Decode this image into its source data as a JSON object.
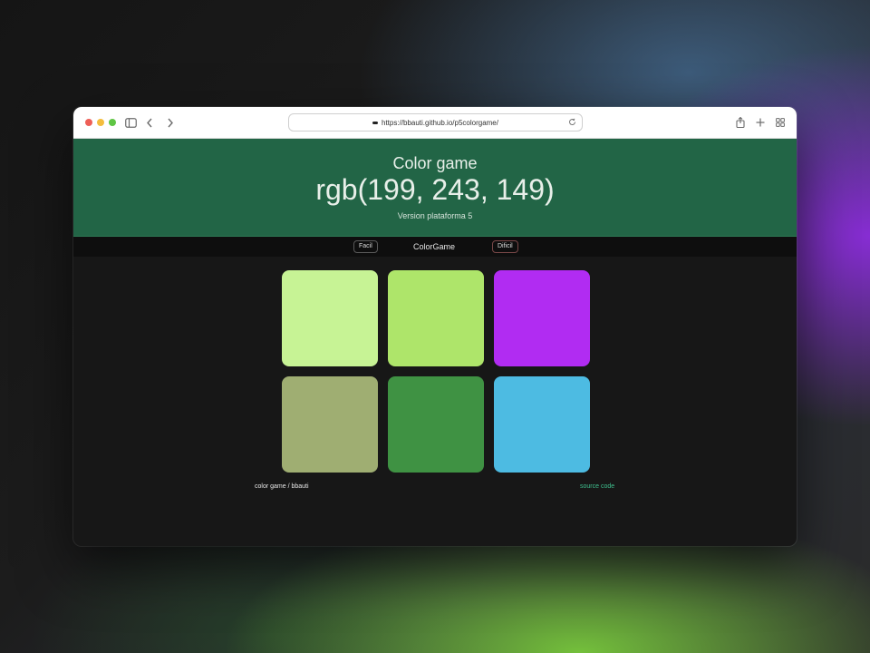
{
  "browser": {
    "url": "https://bbauti.github.io/p5colorgame/"
  },
  "header": {
    "title": "Color game",
    "rgb": "rgb(199, 243, 149)",
    "version": "Version plataforma 5"
  },
  "nav": {
    "easy_label": "Facil",
    "title": "ColorGame",
    "hard_label": "Dificil"
  },
  "squares": [
    {
      "color": "#c7f395"
    },
    {
      "color": "#aee56a"
    },
    {
      "color": "#b12cf2"
    },
    {
      "color": "#9fae72"
    },
    {
      "color": "#3f9243"
    },
    {
      "color": "#4dbbe2"
    }
  ],
  "footer": {
    "credit": "color game / bbauti",
    "source_label": "source code"
  },
  "colors": {
    "header_bg": "#226546",
    "page_bg": "#171717",
    "link": "#3fbf8e"
  }
}
